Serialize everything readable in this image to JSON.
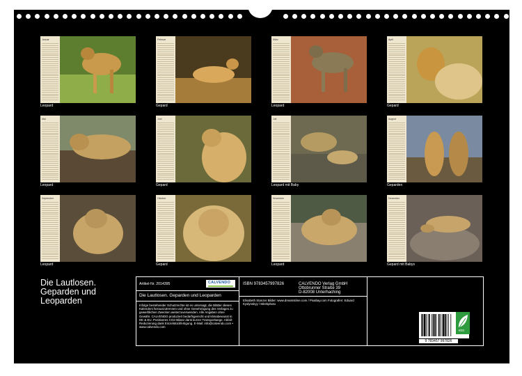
{
  "months": [
    {
      "name": "Januar",
      "caption": "Leopard"
    },
    {
      "name": "Februar",
      "caption": "Gepard"
    },
    {
      "name": "März",
      "caption": "Leopard"
    },
    {
      "name": "April",
      "caption": "Gepard"
    },
    {
      "name": "Mai",
      "caption": "Leopard"
    },
    {
      "name": "Juni",
      "caption": "Gepard"
    },
    {
      "name": "Juli",
      "caption": "Leopard mit Baby"
    },
    {
      "name": "August",
      "caption": "Geparden"
    },
    {
      "name": "September",
      "caption": "Leopard"
    },
    {
      "name": "Oktober",
      "caption": "Gepard"
    },
    {
      "name": "November",
      "caption": "Leopard"
    },
    {
      "name": "Dezember",
      "caption": "Gepard mit Babys"
    }
  ],
  "title": {
    "line1": "Die Lautlosen.",
    "line2": "Geparden und",
    "line3": "Leoparden"
  },
  "info": {
    "article": "Artikel-Nr. 2014395",
    "logo": "CALVENDO",
    "subtitle": "Die Lautlosen. Geparden und Leoparden",
    "body": "Infolge bestehender Schutzrechte ist es untersagt, die Blätter dieses Kalenders herauszutrennen und ohne Genehmigung des Verlages zu gewerblichen Zwecken weiterzuverwenden. Alle Angaben ohne Gewähr. CALVENDO produziert bedarfsgerecht und klimabewusst in DE & EU. Positiveres CO2-Bilanz dank kurzer Transportwege. Abfall-Reduzierung dank Einzelstückfertigung. E-Mail: info@calvendo.com • www.calvendo.com",
    "isbn": "ISBN 9783457997826",
    "publisher1": "CALVENDO Verlag GmbH",
    "publisher2": "Ottobrunner Straße 39",
    "publisher3": "D-82008 Unterhaching",
    "credits": "Elisabeth Stanzer Bilder: www.dreamstime.com / Pixabay.com Fotografen: Eduard Kyslynskyy / Mirekphoto",
    "barcode_digits": "9 783457 997826",
    "eco_label": "eco"
  },
  "colors": {
    "background": "#000000",
    "strip": "#efe6cf"
  }
}
